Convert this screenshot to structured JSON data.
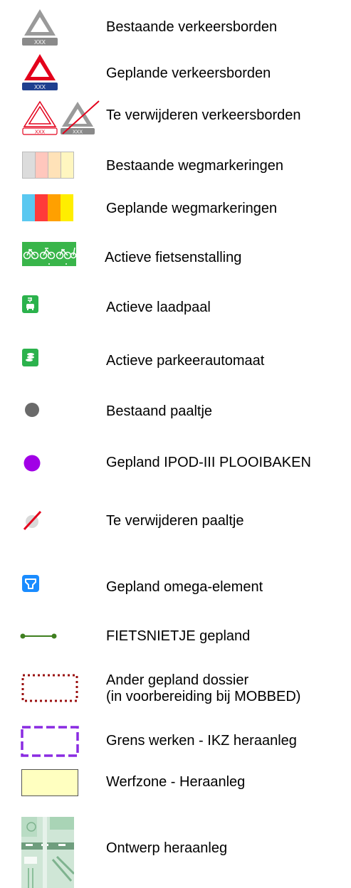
{
  "legend": {
    "items": [
      {
        "id": "existing-signs",
        "label": "Bestaande verkeersborden",
        "icon": "grey-warning-triangle-sign",
        "plate_text": "XXX"
      },
      {
        "id": "planned-signs",
        "label": "Geplande verkeersborden",
        "icon": "red-warning-triangle-sign",
        "plate_text": "XXX"
      },
      {
        "id": "remove-signs",
        "label": "Te verwijderen verkeersborden",
        "icon": "crossed-out-signs",
        "plate_text": "XXX"
      },
      {
        "id": "existing-markings",
        "label": "Bestaande wegmarkeringen",
        "icon": "pale-color-swatches"
      },
      {
        "id": "planned-markings",
        "label": "Geplande wegmarkeringen",
        "icon": "bright-color-swatches"
      },
      {
        "id": "bike-parking",
        "label": "Actieve fietsenstalling",
        "icon": "bicycle-rack-icon"
      },
      {
        "id": "charging-station",
        "label": "Actieve laadpaal",
        "icon": "ev-charger-icon"
      },
      {
        "id": "parking-meter",
        "label": "Actieve parkeerautomaat",
        "icon": "parking-meter-icon"
      },
      {
        "id": "existing-post",
        "label": "Bestaand paaltje",
        "icon": "grey-dot"
      },
      {
        "id": "planned-post",
        "label": "Gepland IPOD-III PLOOIBAKEN",
        "icon": "purple-dot"
      },
      {
        "id": "remove-post",
        "label": "Te verwijderen paaltje",
        "icon": "crossed-grey-dot"
      },
      {
        "id": "omega-element",
        "label": "Gepland omega-element",
        "icon": "omega-element-icon"
      },
      {
        "id": "bike-staple",
        "label": "FIETSNIETJE gepland",
        "icon": "green-line-with-dots"
      },
      {
        "id": "other-dossier",
        "label_lines": [
          "Ander gepland dossier",
          "(in voorbereiding bij MOBBED)"
        ],
        "icon": "dotted-red-rectangle"
      },
      {
        "id": "works-boundary",
        "label": "Grens werken - IKZ heraanleg",
        "icon": "dashed-purple-rectangle"
      },
      {
        "id": "site-zone",
        "label": "Werfzone - Heraanleg",
        "icon": "light-yellow-rectangle"
      },
      {
        "id": "design",
        "label": "Ontwerp heraanleg",
        "icon": "design-plan-thumbnail"
      }
    ],
    "colors": {
      "existing_grey": "#9a9a9a",
      "planned_red": "#e3001b",
      "plate_blue": "#1f3f8f",
      "bike_green": "#39b54a",
      "device_green": "#2bb24c",
      "purple": "#a100e6",
      "omega_blue": "#1a8cff",
      "staple_green": "#3f7f1f",
      "dossier_red": "#9a0f0f",
      "boundary_purple": "#8a2be2",
      "site_yellow": "#ffffc0"
    }
  }
}
